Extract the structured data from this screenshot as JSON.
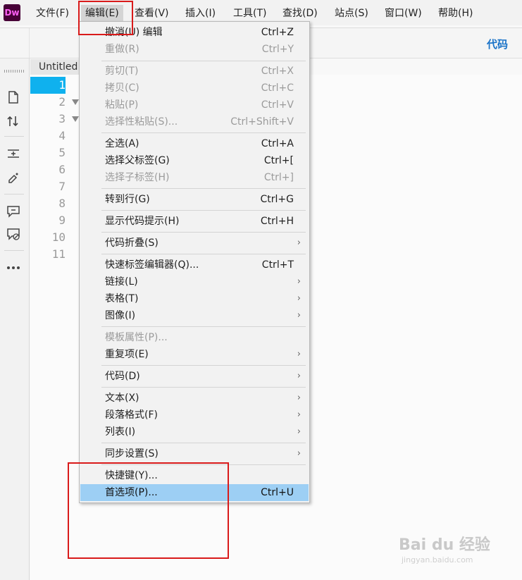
{
  "app": {
    "logo": "Dw"
  },
  "menubar": {
    "items": [
      "文件(F)",
      "编辑(E)",
      "查看(V)",
      "插入(I)",
      "工具(T)",
      "查找(D)",
      "站点(S)",
      "窗口(W)",
      "帮助(H)"
    ],
    "active_index": 1
  },
  "toolbar": {
    "view_label": "代码"
  },
  "document": {
    "tab_title": "Untitled",
    "line_numbers": [
      "1",
      "2",
      "3",
      "4",
      "5",
      "6",
      "7",
      "8",
      "9",
      "10",
      "11"
    ],
    "active_line": "1"
  },
  "edit_menu": {
    "items": [
      {
        "label": "撤消(U) 编辑",
        "shortcut": "Ctrl+Z",
        "state": "enabled"
      },
      {
        "label": "重做(R)",
        "shortcut": "Ctrl+Y",
        "state": "disabled"
      },
      {
        "label": "剪切(T)",
        "shortcut": "Ctrl+X",
        "state": "disabled"
      },
      {
        "label": "拷贝(C)",
        "shortcut": "Ctrl+C",
        "state": "disabled"
      },
      {
        "label": "粘贴(P)",
        "shortcut": "Ctrl+V",
        "state": "disabled"
      },
      {
        "label": "选择性粘贴(S)...",
        "shortcut": "Ctrl+Shift+V",
        "state": "disabled"
      },
      {
        "label": "全选(A)",
        "shortcut": "Ctrl+A",
        "state": "enabled"
      },
      {
        "label": "选择父标签(G)",
        "shortcut": "Ctrl+[",
        "state": "enabled"
      },
      {
        "label": "选择子标签(H)",
        "shortcut": "Ctrl+]",
        "state": "disabled"
      },
      {
        "label": "转到行(G)",
        "shortcut": "Ctrl+G",
        "state": "enabled"
      },
      {
        "label": "显示代码提示(H)",
        "shortcut": "Ctrl+H",
        "state": "enabled"
      },
      {
        "label": "代码折叠(S)",
        "submenu": true,
        "state": "enabled"
      },
      {
        "label": "快速标签编辑器(Q)...",
        "shortcut": "Ctrl+T",
        "state": "enabled"
      },
      {
        "label": "链接(L)",
        "submenu": true,
        "state": "enabled"
      },
      {
        "label": "表格(T)",
        "submenu": true,
        "state": "enabled"
      },
      {
        "label": "图像(I)",
        "submenu": true,
        "state": "enabled"
      },
      {
        "label": "模板属性(P)...",
        "state": "disabled"
      },
      {
        "label": "重复项(E)",
        "submenu": true,
        "state": "enabled"
      },
      {
        "label": "代码(D)",
        "submenu": true,
        "state": "enabled"
      },
      {
        "label": "文本(X)",
        "submenu": true,
        "state": "enabled"
      },
      {
        "label": "段落格式(F)",
        "submenu": true,
        "state": "enabled"
      },
      {
        "label": "列表(I)",
        "submenu": true,
        "state": "enabled"
      },
      {
        "label": "同步设置(S)",
        "submenu": true,
        "state": "enabled"
      },
      {
        "label": "快捷键(Y)...",
        "state": "enabled"
      },
      {
        "label": "首选项(P)...",
        "shortcut": "Ctrl+U",
        "state": "highlighted"
      }
    ]
  },
  "watermark": {
    "text": "Bai du 经验",
    "sub": "jingyan.baidu.com"
  }
}
